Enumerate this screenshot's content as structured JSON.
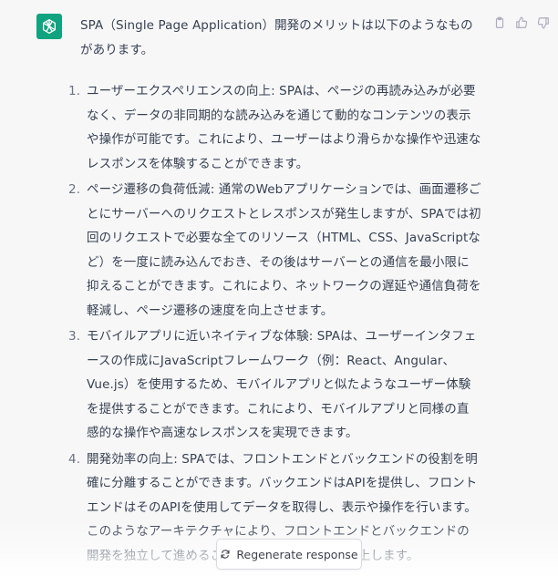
{
  "message": {
    "intro": "SPA（Single Page Application）開発のメリットは以下のようなものがあります。",
    "points": [
      {
        "number": "1.",
        "text": "ユーザーエクスペリエンスの向上: SPAは、ページの再読み込みが必要なく、データの非同期的な読み込みを通じて動的なコンテンツの表示や操作が可能です。これにより、ユーザーはより滑らかな操作や迅速なレスポンスを体験することができます。"
      },
      {
        "number": "2.",
        "text": "ページ遷移の負荷低減: 通常のWebアプリケーションでは、画面遷移ごとにサーバーへのリクエストとレスポンスが発生しますが、SPAでは初回のリクエストで必要な全てのリソース（HTML、CSS、JavaScriptなど）を一度に読み込んでおき、その後はサーバーとの通信を最小限に抑えることができます。これにより、ネットワークの遅延や通信負荷を軽減し、ページ遷移の速度を向上させます。"
      },
      {
        "number": "3.",
        "text": "モバイルアプリに近いネイティブな体験: SPAは、ユーザーインタフェースの作成にJavaScriptフレームワーク（例：React、Angular、Vue.js）を使用するため、モバイルアプリと似たようなユーザー体験を提供することができます。これにより、モバイルアプリと同様の直感的な操作や高速なレスポンスを実現できます。"
      },
      {
        "number": "4.",
        "text": "開発効率の向上: SPAでは、フロントエンドとバックエンドの役割を明確に分離することができます。バックエンドはAPIを提供し、フロントエンドはそのAPIを使用してデータを取得し、表示や操作を行います。このようなアーキテクチャにより、フロントエンドとバックエンドの開発を独立して進めることができ、開発効率が向上します。"
      }
    ]
  },
  "actions": {
    "copy_icon": "clipboard-icon",
    "like_icon": "thumbs-up-icon",
    "dislike_icon": "thumbs-down-icon"
  },
  "regenerate": {
    "label": "Regenerate response",
    "icon": "refresh-icon"
  },
  "colors": {
    "avatar_bg": "#10a37f",
    "thread_bg": "#f7f7f8",
    "text": "#374151"
  }
}
